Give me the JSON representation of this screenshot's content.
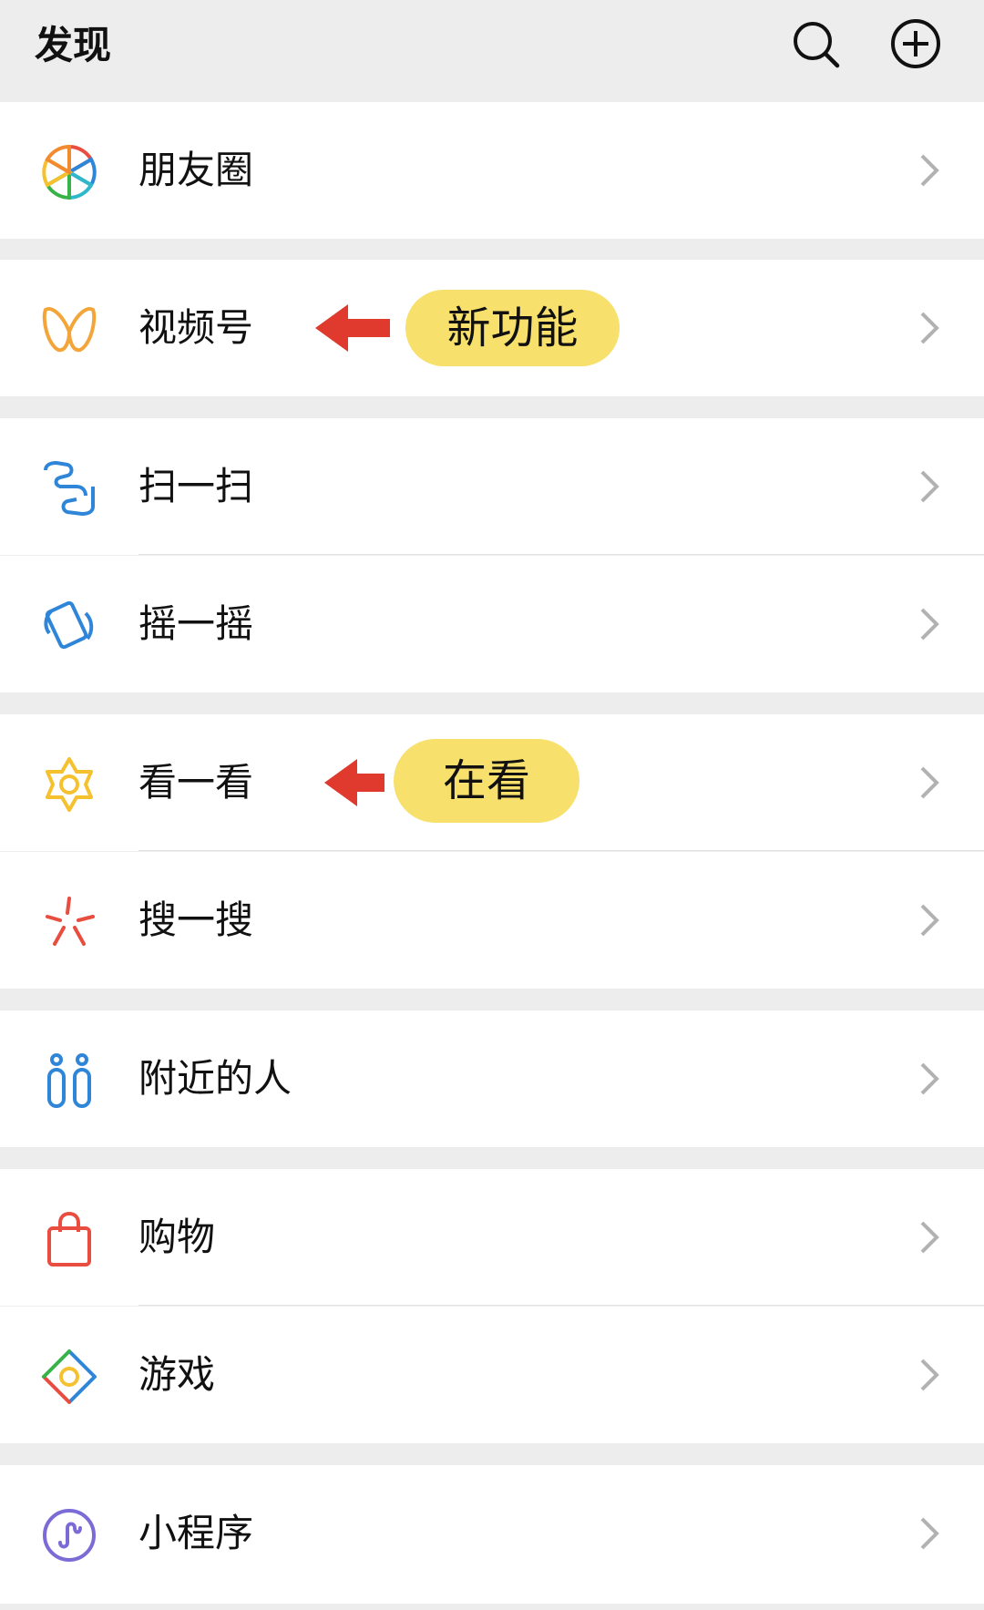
{
  "header": {
    "title": "发现"
  },
  "items": [
    {
      "label": "朋友圈"
    },
    {
      "label": "视频号"
    },
    {
      "label": "扫一扫"
    },
    {
      "label": "摇一摇"
    },
    {
      "label": "看一看"
    },
    {
      "label": "搜一搜"
    },
    {
      "label": "附近的人"
    },
    {
      "label": "购物"
    },
    {
      "label": "游戏"
    },
    {
      "label": "小程序"
    }
  ],
  "annotations": {
    "channels": "新功能",
    "look": "在看"
  },
  "icons": {
    "header_search": "search-icon",
    "header_add": "add-circle-icon",
    "moments": "aperture-icon",
    "channels": "butterfly-icon",
    "scan": "scan-icon",
    "shake": "shake-icon",
    "top_stories": "star-flower-icon",
    "search": "sparkle-icon",
    "nearby": "people-icon",
    "shopping": "bag-icon",
    "games": "diamond-icon",
    "mini_programs": "mini-program-icon",
    "chevron": "chevron-right-icon",
    "pointer": "red-arrow-icon"
  },
  "colors": {
    "background": "#ededed",
    "row": "#ffffff",
    "annotation_pill": "#f7e06b",
    "annotation_arrow": "#e03a2f",
    "chevron": "#b2b2b2"
  }
}
